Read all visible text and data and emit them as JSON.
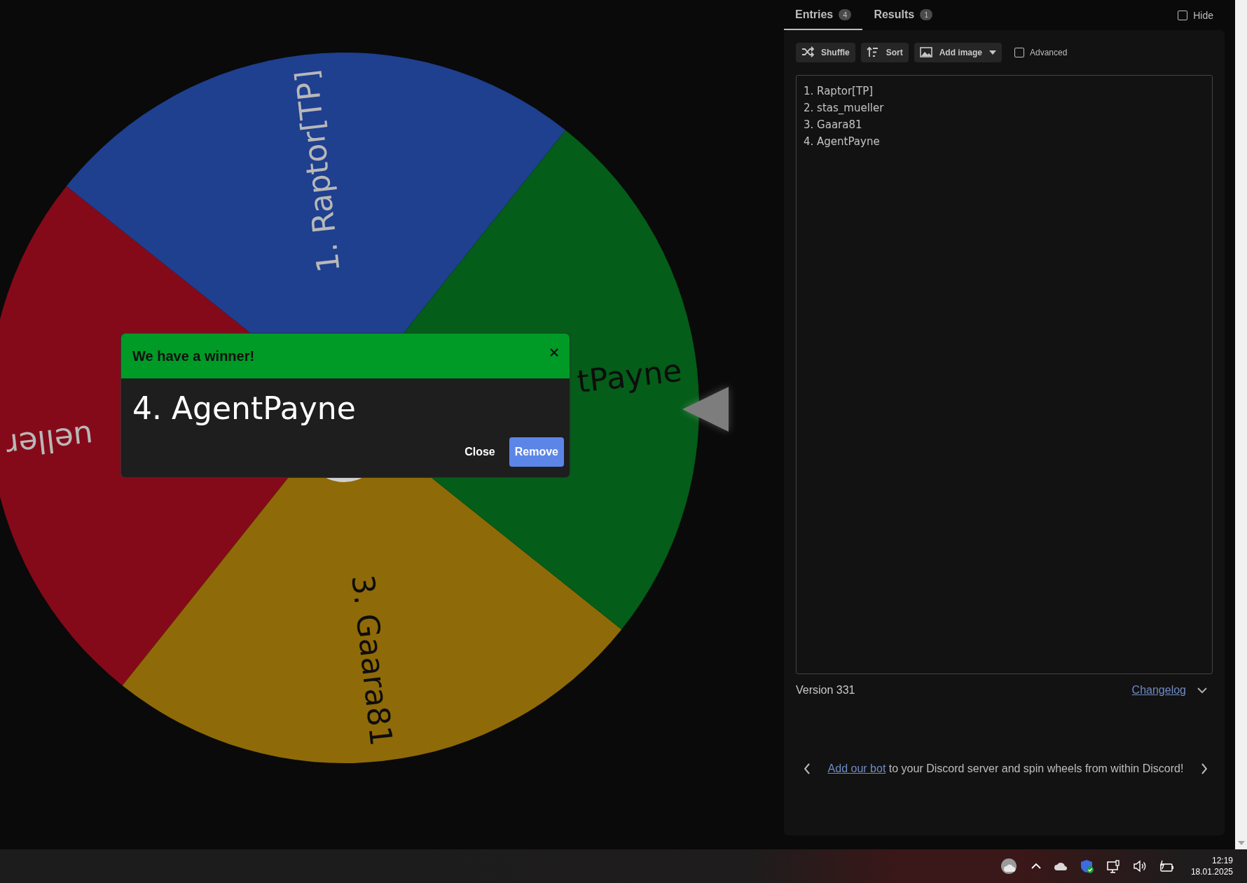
{
  "wheel": {
    "segments": [
      {
        "label": "1. Raptor[TP]",
        "color": "#1f3f8f",
        "kind": "light"
      },
      {
        "label": "ueller",
        "color": "#850a19",
        "kind": "light"
      },
      {
        "label": "3. Gaara81",
        "color": "#8f6a08",
        "kind": "dark"
      },
      {
        "label": "tPayne",
        "color": "#045d18",
        "kind": "dark"
      }
    ]
  },
  "dialog": {
    "title": "We have a winner!",
    "winner": "4. AgentPayne",
    "buttons": [
      {
        "label": "Close",
        "kind": "text"
      },
      {
        "label": "Remove",
        "kind": "primary"
      }
    ]
  },
  "tabs": [
    {
      "label": "Entries",
      "count": "4",
      "selected": true
    },
    {
      "label": "Results",
      "count": "1",
      "selected": false
    }
  ],
  "hide": {
    "label": "Hide",
    "checked": false
  },
  "toolbar": [
    {
      "label": "Shuffle",
      "kind": "shuffle"
    },
    {
      "label": "Sort",
      "kind": "sort"
    },
    {
      "label": "Add image",
      "kind": "image"
    }
  ],
  "advanced": {
    "label": "Advanced",
    "checked": false
  },
  "entries": [
    "1. Raptor[TP]",
    "2. stas_mueller",
    "3. Gaara81",
    "4. AgentPayne"
  ],
  "version": "Version 331",
  "changelog": "Changelog",
  "promo": {
    "link": "Add our bot",
    "text": "to your Discord server and spin wheels from within Discord!"
  },
  "clock": {
    "time": "12:19",
    "date": "18.01.2025"
  }
}
